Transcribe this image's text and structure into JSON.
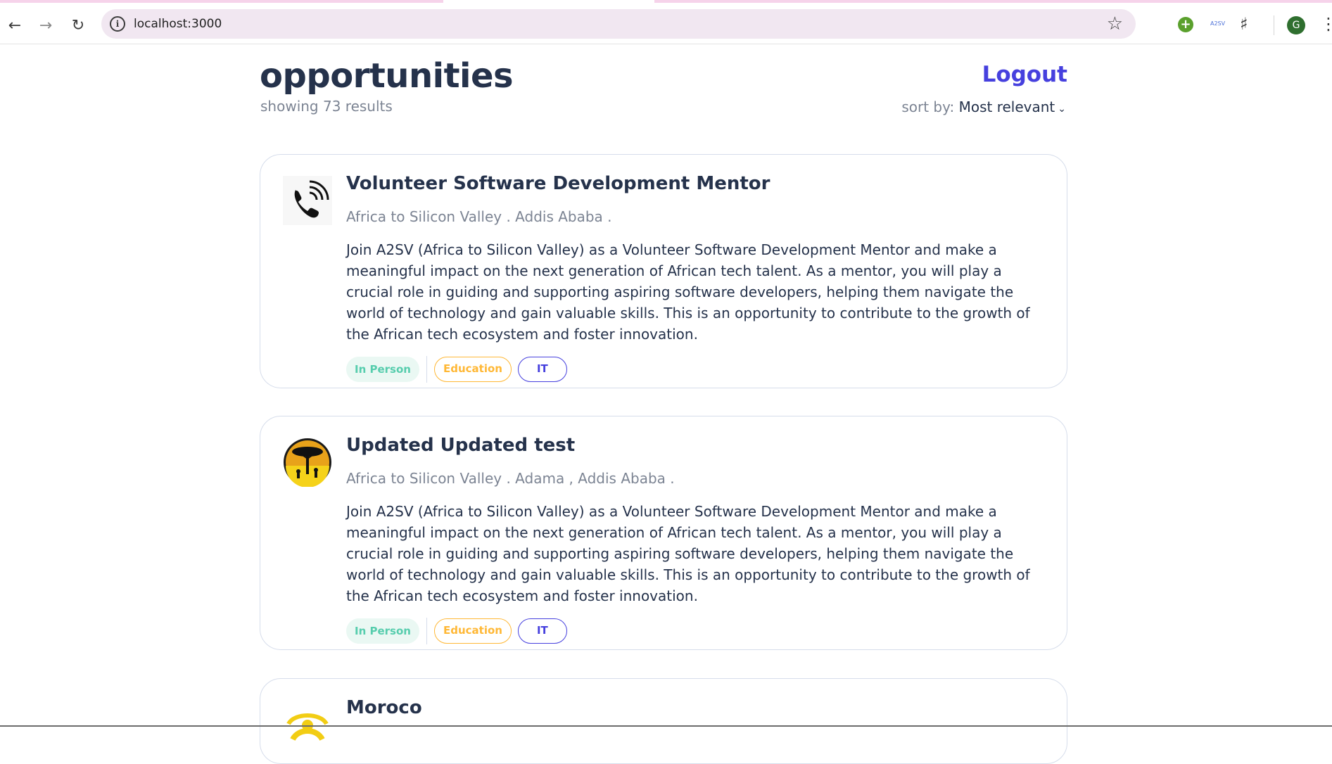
{
  "browser": {
    "url": "localhost:3000",
    "profile_initial": "G",
    "ext_label": "A2SV"
  },
  "header": {
    "title": "opportunities",
    "results": "showing 73 results",
    "logout": "Logout",
    "sort_label": "sort by:",
    "sort_value": "Most relevant"
  },
  "cards": [
    {
      "title": "Volunteer Software Development Mentor",
      "meta": "Africa to Silicon Valley . Addis Ababa .",
      "description": "Join A2SV (Africa to Silicon Valley) as a Volunteer Software Development Mentor and make a meaningful impact on the next generation of African tech talent. As a mentor, you will play a crucial role in guiding and supporting aspiring software developers, helping them navigate the world of technology and gain valuable skills. This is an opportunity to contribute to the growth of the African tech ecosystem and foster innovation.",
      "tags": [
        "In Person",
        "Education",
        "IT"
      ],
      "logo": "phone-icon"
    },
    {
      "title": "Updated Updated test",
      "meta": "Africa to Silicon Valley . Adama , Addis Ababa .",
      "description": "Join A2SV (Africa to Silicon Valley) as a Volunteer Software Development Mentor and make a meaningful impact on the next generation of African tech talent. As a mentor, you will play a crucial role in guiding and supporting aspiring software developers, helping them navigate the world of technology and gain valuable skills. This is an opportunity to contribute to the growth of the African tech ecosystem and foster innovation.",
      "tags": [
        "In Person",
        "Education",
        "IT"
      ],
      "logo": "tree-logo"
    },
    {
      "title": "Moroco",
      "logo": "yellow-logo"
    }
  ],
  "colors": {
    "brand": "#4640de",
    "text": "#25324b",
    "muted": "#7c8493",
    "tag_green": "#56cdad",
    "tag_orange": "#ffb836"
  }
}
